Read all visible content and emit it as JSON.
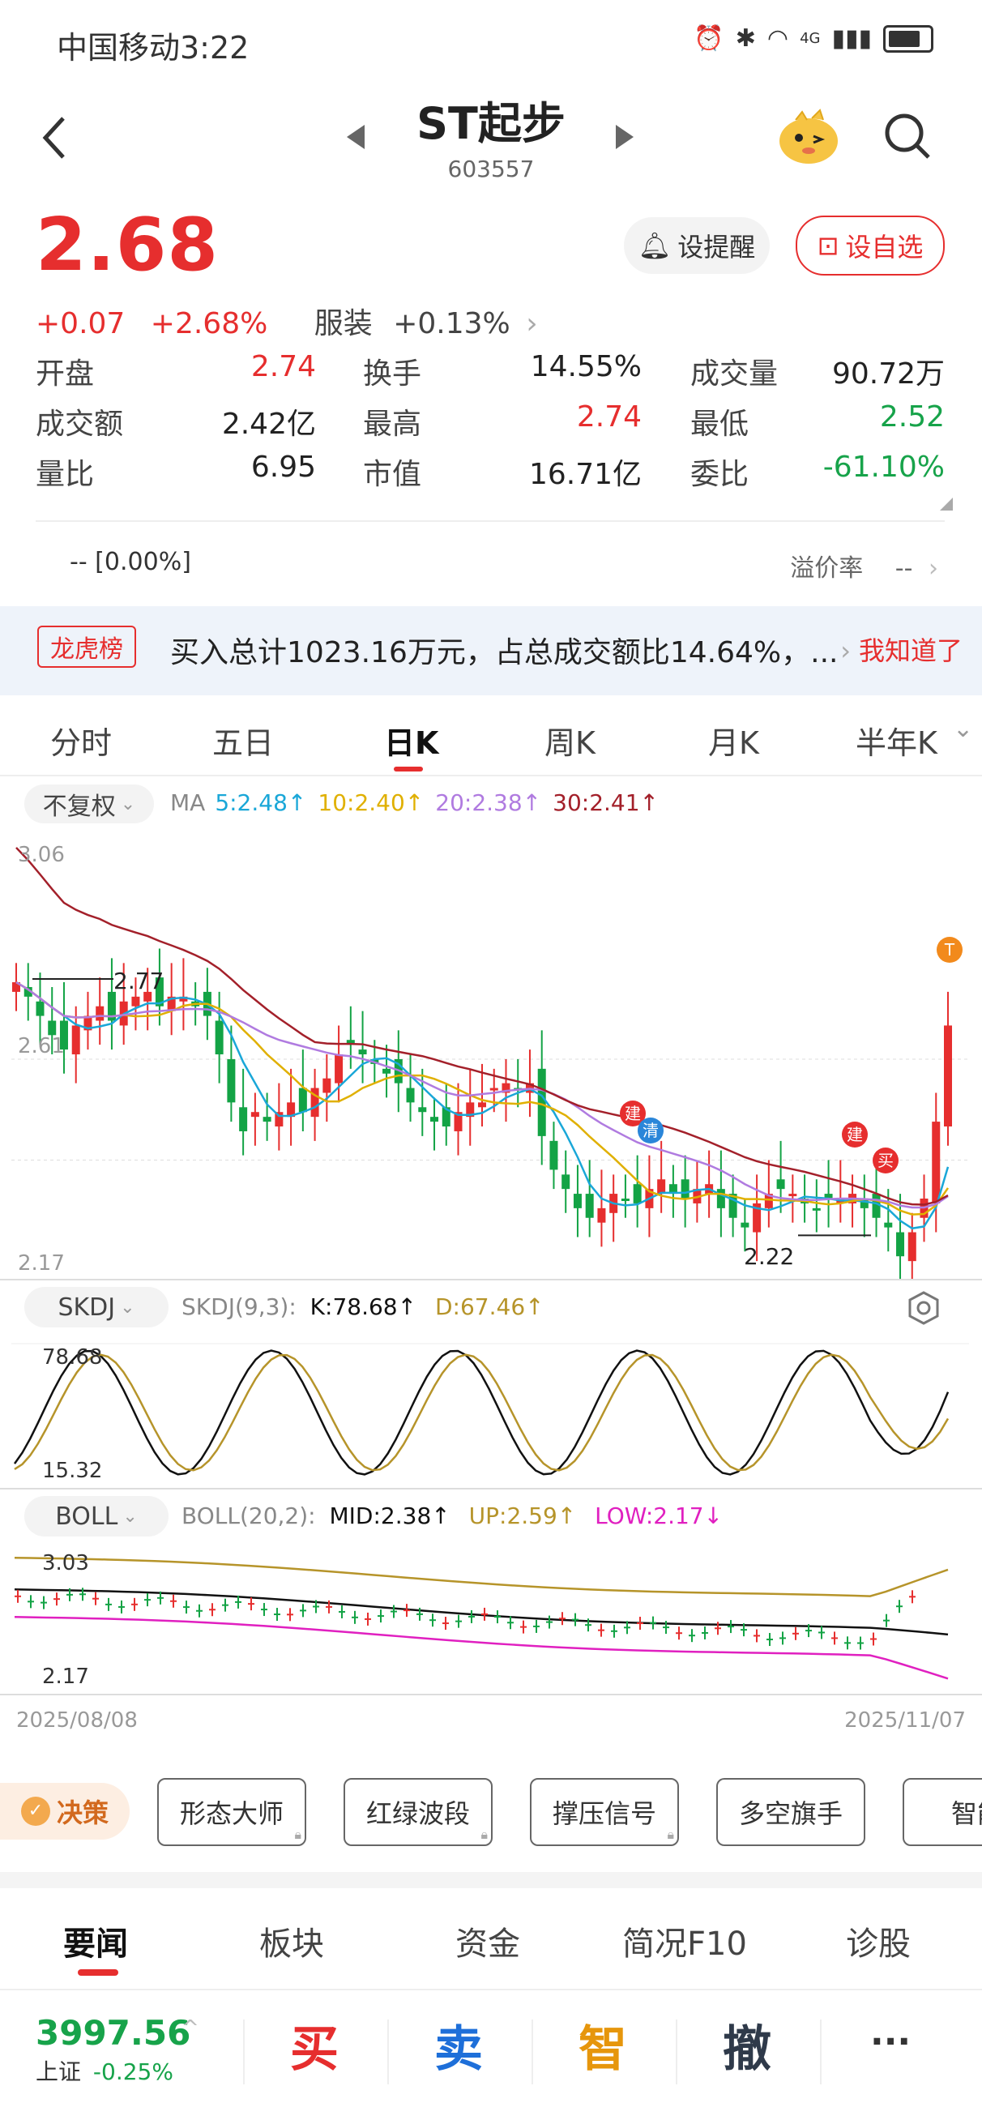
{
  "status": {
    "carrier_time": "中国移动3:22",
    "net": "4G"
  },
  "header": {
    "name": "ST起步",
    "code": "603557"
  },
  "quote": {
    "price": "2.68",
    "change": "+0.07",
    "change_pct": "+2.68%",
    "sector": "服装",
    "sector_pct": "+0.13%",
    "remind_label": "设提醒",
    "watch_label": "设自选"
  },
  "stats": [
    {
      "label": "开盘",
      "value": "2.74",
      "color": "red"
    },
    {
      "label": "换手",
      "value": "14.55%",
      "color": "black"
    },
    {
      "label": "成交量",
      "value": "90.72万",
      "color": "black"
    },
    {
      "label": "成交额",
      "value": "2.42亿",
      "color": "black"
    },
    {
      "label": "最高",
      "value": "2.74",
      "color": "red"
    },
    {
      "label": "最低",
      "value": "2.52",
      "color": "green"
    },
    {
      "label": "量比",
      "value": "6.95",
      "color": "black"
    },
    {
      "label": "市值",
      "value": "16.71亿",
      "color": "black"
    },
    {
      "label": "委比",
      "value": "-61.10%",
      "color": "green"
    }
  ],
  "premium": {
    "left": "-- [0.00%]",
    "label": "溢价率",
    "value": "--"
  },
  "notice": {
    "tag": "龙虎榜",
    "text": "买入总计1023.16万元，占总成交额比14.64%，...",
    "action": "我知道了"
  },
  "period_tabs": [
    "分时",
    "五日",
    "日K",
    "周K",
    "月K",
    "半年K"
  ],
  "active_tab": "日K",
  "ma": {
    "fq": "不复权",
    "label": "MA",
    "items": [
      {
        "text": "5:2.48↑",
        "color": "#1aa7d8"
      },
      {
        "text": "10:2.40↑",
        "color": "#e0b000"
      },
      {
        "text": "20:2.38↑",
        "color": "#b07be0"
      },
      {
        "text": "30:2.41↑",
        "color": "#a3202a"
      }
    ]
  },
  "kchart": {
    "y_top": "3.06",
    "y_mid": "2.61",
    "y_bottom": "2.17",
    "high_label": "2.77",
    "low_label": "2.22",
    "marks": {
      "build": "建",
      "clear": "清",
      "buy": "买",
      "t": "T"
    }
  },
  "skdj": {
    "name": "SKDJ",
    "params": "SKDJ(9,3):",
    "k": "K:78.68↑",
    "d": "D:67.46↑",
    "y_top": "78.68",
    "y_bottom": "15.32"
  },
  "boll": {
    "name": "BOLL",
    "params": "BOLL(20,2):",
    "mid": "MID:2.38↑",
    "up": "UP:2.59↑",
    "low": "LOW:2.17↓",
    "y_top": "3.03",
    "y_bottom": "2.17"
  },
  "dates": {
    "start": "2025/08/08",
    "end": "2025/11/07"
  },
  "decision": {
    "label": "决策",
    "buttons": [
      "形态大师",
      "红绿波段",
      "撑压信号",
      "多空旗手",
      "智能"
    ]
  },
  "bottom_tabs": [
    "要闻",
    "板块",
    "资金",
    "简况F10",
    "诊股"
  ],
  "index": {
    "value": "3997.56",
    "name": "上证",
    "pct": "-0.25%"
  },
  "trade": {
    "buy": "买",
    "sell": "卖",
    "smart": "智",
    "cancel": "撤",
    "more": "···"
  },
  "chart_data": {
    "type": "candlestick",
    "start": "2025/08/08",
    "end": "2025/11/07",
    "ylim": [
      2.17,
      3.06
    ],
    "note_high": 2.77,
    "note_low": 2.22
  }
}
